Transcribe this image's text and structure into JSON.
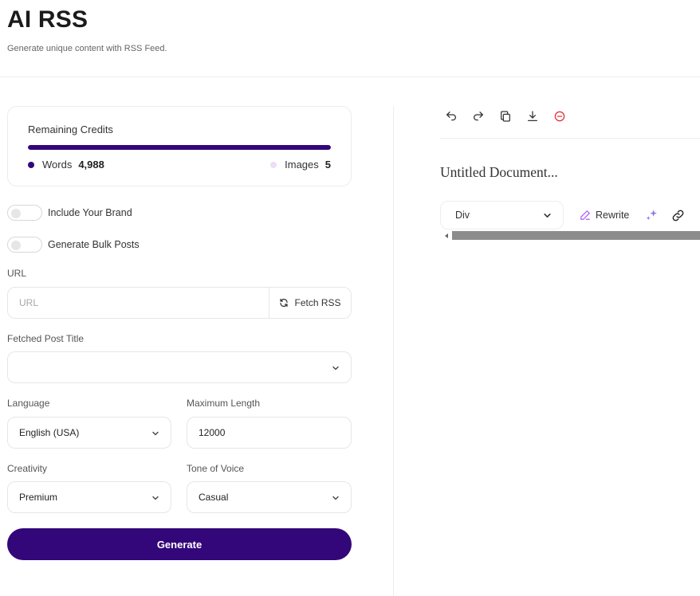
{
  "header": {
    "title": "AI RSS",
    "subtitle": "Generate unique content with RSS Feed."
  },
  "credits": {
    "title": "Remaining Credits",
    "words_label": "Words",
    "words_value": "4,988",
    "images_label": "Images",
    "images_value": "5",
    "words_fraction": 1.0
  },
  "toggles": {
    "brand_label": "Include Your Brand",
    "bulk_label": "Generate Bulk Posts"
  },
  "url": {
    "label": "URL",
    "placeholder": "URL",
    "value": "",
    "fetch_label": "Fetch RSS"
  },
  "post_title": {
    "label": "Fetched Post Title",
    "value": ""
  },
  "language": {
    "label": "Language",
    "value": "English (USA)"
  },
  "max_length": {
    "label": "Maximum Length",
    "value": "12000"
  },
  "creativity": {
    "label": "Creativity",
    "value": "Premium"
  },
  "tone": {
    "label": "Tone of Voice",
    "value": "Casual"
  },
  "generate_label": "Generate",
  "editor": {
    "doc_title": "Untitled Document...",
    "block_type": "Div",
    "rewrite_label": "Rewrite",
    "toolbar_icons": [
      "undo-icon",
      "redo-icon",
      "copy-icon",
      "download-icon",
      "remove-icon"
    ]
  },
  "colors": {
    "primary": "#33067a",
    "image_dot": "#eedcf9",
    "danger": "#e0383e",
    "sparkle": "#8b7cf0",
    "rewrite_icon": "#a855f7"
  }
}
